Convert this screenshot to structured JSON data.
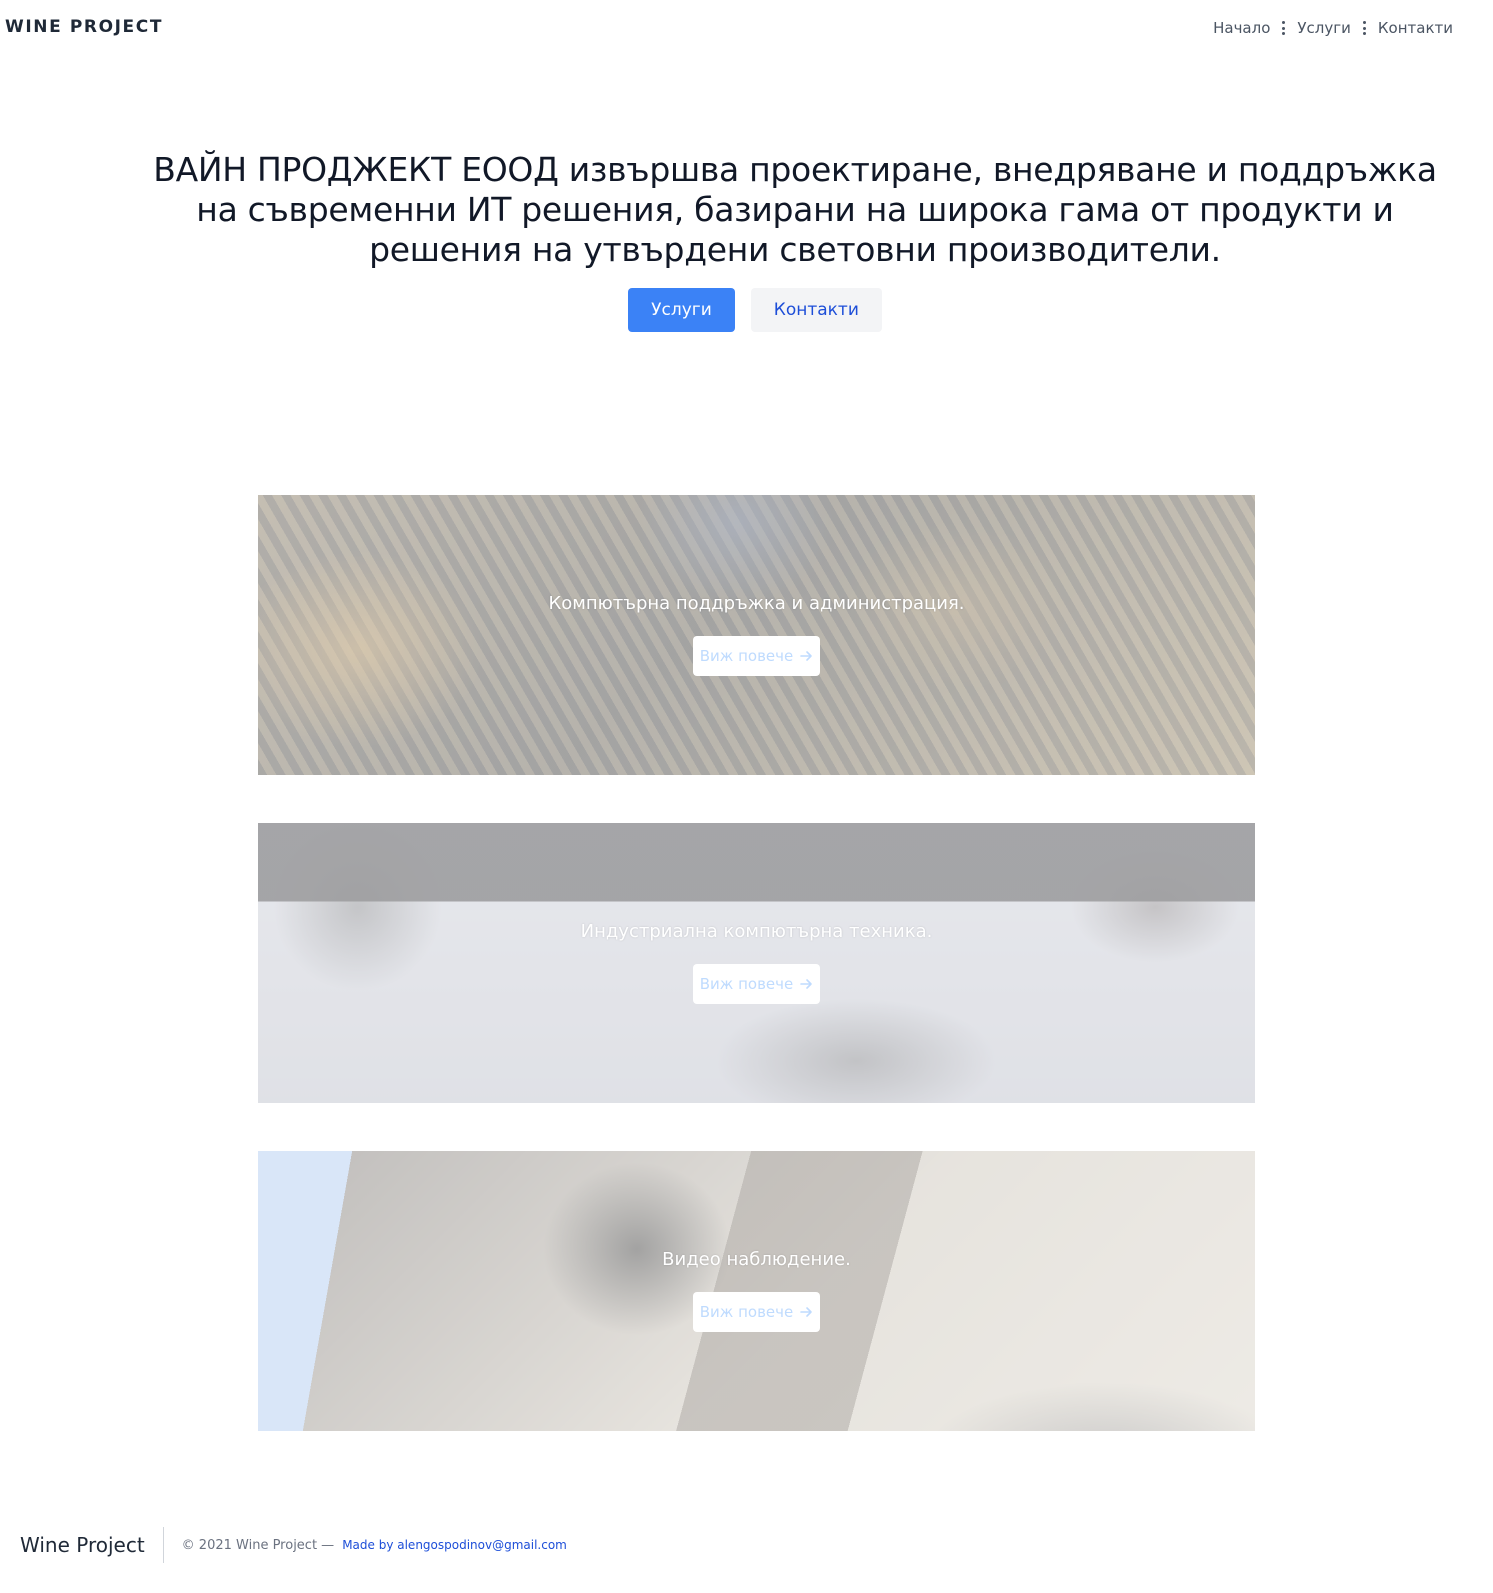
{
  "header": {
    "brand": "WINE PROJECT",
    "nav": {
      "home": "Начало",
      "services": "Услуги",
      "contacts": "Контакти"
    }
  },
  "hero": {
    "title": "ВАЙН ПРОДЖЕКТ ЕООД извършва проектиране, внедряване и поддръжка на съвременни ИТ решения, базирани на широка гама от продукти и решения на утвърдени световни производители.",
    "primary_button": "Услуги",
    "secondary_button": "Контакти"
  },
  "services": [
    {
      "title": "Компютърна поддръжка и администрация.",
      "button": "Виж повече"
    },
    {
      "title": "Индустриална компютърна техника.",
      "button": "Виж повече"
    },
    {
      "title": "Видео наблюдение.",
      "button": "Виж повече"
    }
  ],
  "footer": {
    "brand": "Wine Project",
    "copyright": "© 2021 Wine Project —",
    "credit": "Made by alengospodinov@gmail.com"
  },
  "colors": {
    "accent": "#3b82f6",
    "link": "#1d4ed8",
    "text": "#111827"
  },
  "icons": {
    "nav_separator": "vertical-dots-icon",
    "more_arrow": "arrow-right-icon"
  }
}
